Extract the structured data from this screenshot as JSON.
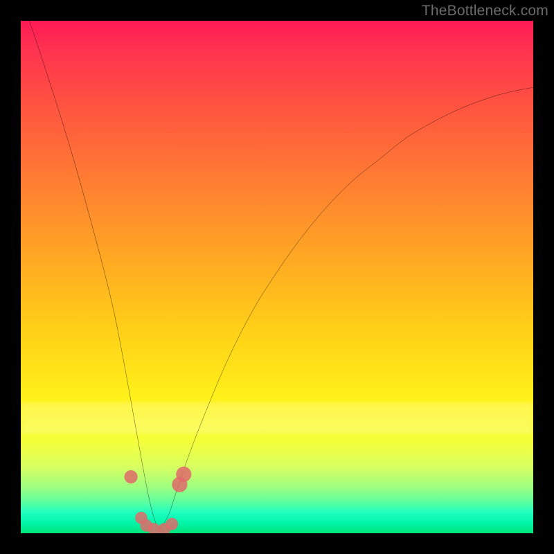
{
  "watermark": "TheBottleneck.com",
  "colors": {
    "frame": "#000000",
    "curve_stroke": "#000000",
    "marker_fill": "#e06a6a",
    "gradient_stops": [
      "#ff1a55",
      "#ff3050",
      "#ff5540",
      "#ff7a33",
      "#ffa424",
      "#ffcf18",
      "#fff41a",
      "#f5ff3a",
      "#d8ff60",
      "#9eff80",
      "#5affa0",
      "#1effc0",
      "#00f5a8",
      "#00e47a"
    ]
  },
  "chart_data": {
    "type": "line",
    "title": "",
    "xlabel": "",
    "ylabel": "",
    "xlim": [
      0,
      100
    ],
    "ylim": [
      0,
      100
    ],
    "x_at_minimum": 27,
    "series": [
      {
        "name": "bottleneck-curve",
        "x": [
          0,
          5,
          10,
          15,
          18,
          20,
          22,
          24,
          25,
          26,
          27,
          28,
          29,
          30,
          32,
          35,
          40,
          45,
          50,
          55,
          60,
          65,
          70,
          75,
          80,
          85,
          90,
          95,
          100
        ],
        "y": [
          105,
          90,
          74,
          56,
          44,
          34,
          23,
          12,
          7,
          3,
          1,
          2,
          4,
          7,
          13,
          21,
          33,
          43,
          51,
          58,
          64,
          69,
          73,
          77,
          80,
          82.5,
          84.5,
          86,
          87
        ]
      }
    ],
    "markers": [
      {
        "x": 21.5,
        "y": 11,
        "r": 1.3
      },
      {
        "x": 23.5,
        "y": 3,
        "r": 1.2
      },
      {
        "x": 24.5,
        "y": 1.5,
        "r": 1.2
      },
      {
        "x": 26.0,
        "y": 0.8,
        "r": 1.2
      },
      {
        "x": 28.0,
        "y": 0.8,
        "r": 1.2
      },
      {
        "x": 29.5,
        "y": 1.8,
        "r": 1.2
      },
      {
        "x": 31.0,
        "y": 9.5,
        "r": 1.5
      },
      {
        "x": 31.8,
        "y": 11.5,
        "r": 1.5
      }
    ],
    "annotations": []
  }
}
